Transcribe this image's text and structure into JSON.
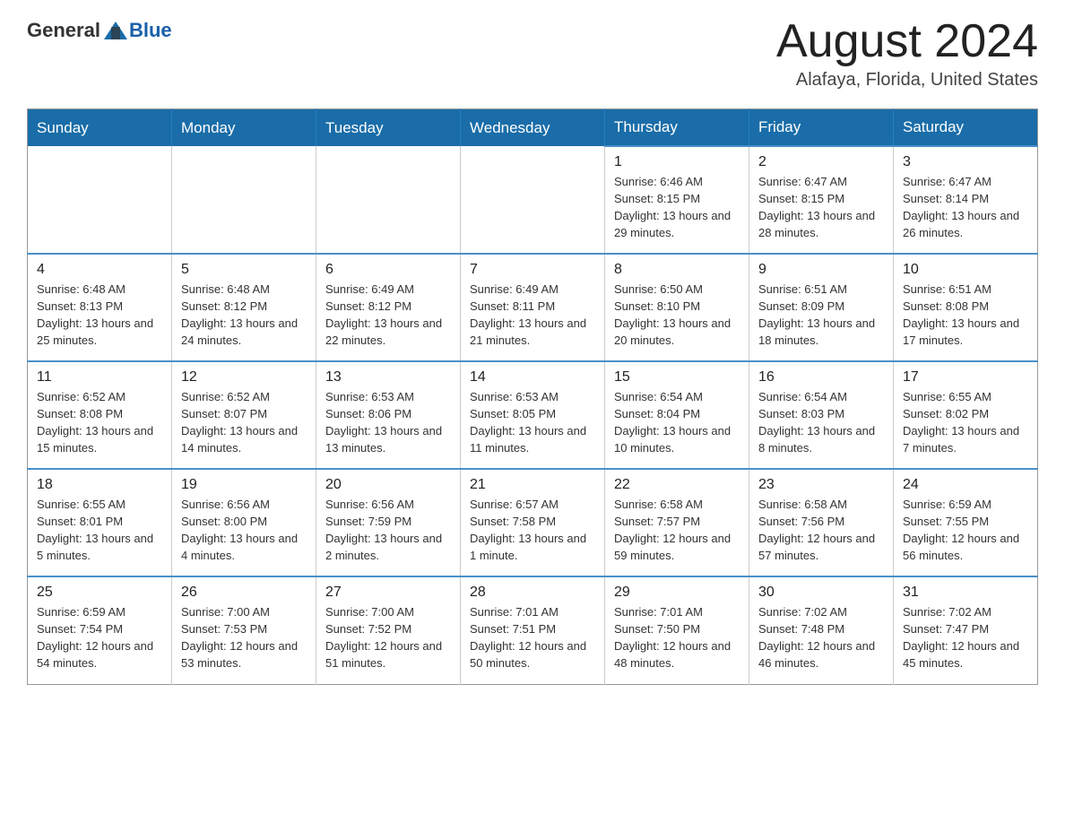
{
  "header": {
    "logo_general": "General",
    "logo_blue": "Blue",
    "month_year": "August 2024",
    "location": "Alafaya, Florida, United States"
  },
  "days_of_week": [
    "Sunday",
    "Monday",
    "Tuesday",
    "Wednesday",
    "Thursday",
    "Friday",
    "Saturday"
  ],
  "weeks": [
    [
      {
        "day": "",
        "sunrise": "",
        "sunset": "",
        "daylight": ""
      },
      {
        "day": "",
        "sunrise": "",
        "sunset": "",
        "daylight": ""
      },
      {
        "day": "",
        "sunrise": "",
        "sunset": "",
        "daylight": ""
      },
      {
        "day": "",
        "sunrise": "",
        "sunset": "",
        "daylight": ""
      },
      {
        "day": "1",
        "sunrise": "Sunrise: 6:46 AM",
        "sunset": "Sunset: 8:15 PM",
        "daylight": "Daylight: 13 hours and 29 minutes."
      },
      {
        "day": "2",
        "sunrise": "Sunrise: 6:47 AM",
        "sunset": "Sunset: 8:15 PM",
        "daylight": "Daylight: 13 hours and 28 minutes."
      },
      {
        "day": "3",
        "sunrise": "Sunrise: 6:47 AM",
        "sunset": "Sunset: 8:14 PM",
        "daylight": "Daylight: 13 hours and 26 minutes."
      }
    ],
    [
      {
        "day": "4",
        "sunrise": "Sunrise: 6:48 AM",
        "sunset": "Sunset: 8:13 PM",
        "daylight": "Daylight: 13 hours and 25 minutes."
      },
      {
        "day": "5",
        "sunrise": "Sunrise: 6:48 AM",
        "sunset": "Sunset: 8:12 PM",
        "daylight": "Daylight: 13 hours and 24 minutes."
      },
      {
        "day": "6",
        "sunrise": "Sunrise: 6:49 AM",
        "sunset": "Sunset: 8:12 PM",
        "daylight": "Daylight: 13 hours and 22 minutes."
      },
      {
        "day": "7",
        "sunrise": "Sunrise: 6:49 AM",
        "sunset": "Sunset: 8:11 PM",
        "daylight": "Daylight: 13 hours and 21 minutes."
      },
      {
        "day": "8",
        "sunrise": "Sunrise: 6:50 AM",
        "sunset": "Sunset: 8:10 PM",
        "daylight": "Daylight: 13 hours and 20 minutes."
      },
      {
        "day": "9",
        "sunrise": "Sunrise: 6:51 AM",
        "sunset": "Sunset: 8:09 PM",
        "daylight": "Daylight: 13 hours and 18 minutes."
      },
      {
        "day": "10",
        "sunrise": "Sunrise: 6:51 AM",
        "sunset": "Sunset: 8:08 PM",
        "daylight": "Daylight: 13 hours and 17 minutes."
      }
    ],
    [
      {
        "day": "11",
        "sunrise": "Sunrise: 6:52 AM",
        "sunset": "Sunset: 8:08 PM",
        "daylight": "Daylight: 13 hours and 15 minutes."
      },
      {
        "day": "12",
        "sunrise": "Sunrise: 6:52 AM",
        "sunset": "Sunset: 8:07 PM",
        "daylight": "Daylight: 13 hours and 14 minutes."
      },
      {
        "day": "13",
        "sunrise": "Sunrise: 6:53 AM",
        "sunset": "Sunset: 8:06 PM",
        "daylight": "Daylight: 13 hours and 13 minutes."
      },
      {
        "day": "14",
        "sunrise": "Sunrise: 6:53 AM",
        "sunset": "Sunset: 8:05 PM",
        "daylight": "Daylight: 13 hours and 11 minutes."
      },
      {
        "day": "15",
        "sunrise": "Sunrise: 6:54 AM",
        "sunset": "Sunset: 8:04 PM",
        "daylight": "Daylight: 13 hours and 10 minutes."
      },
      {
        "day": "16",
        "sunrise": "Sunrise: 6:54 AM",
        "sunset": "Sunset: 8:03 PM",
        "daylight": "Daylight: 13 hours and 8 minutes."
      },
      {
        "day": "17",
        "sunrise": "Sunrise: 6:55 AM",
        "sunset": "Sunset: 8:02 PM",
        "daylight": "Daylight: 13 hours and 7 minutes."
      }
    ],
    [
      {
        "day": "18",
        "sunrise": "Sunrise: 6:55 AM",
        "sunset": "Sunset: 8:01 PM",
        "daylight": "Daylight: 13 hours and 5 minutes."
      },
      {
        "day": "19",
        "sunrise": "Sunrise: 6:56 AM",
        "sunset": "Sunset: 8:00 PM",
        "daylight": "Daylight: 13 hours and 4 minutes."
      },
      {
        "day": "20",
        "sunrise": "Sunrise: 6:56 AM",
        "sunset": "Sunset: 7:59 PM",
        "daylight": "Daylight: 13 hours and 2 minutes."
      },
      {
        "day": "21",
        "sunrise": "Sunrise: 6:57 AM",
        "sunset": "Sunset: 7:58 PM",
        "daylight": "Daylight: 13 hours and 1 minute."
      },
      {
        "day": "22",
        "sunrise": "Sunrise: 6:58 AM",
        "sunset": "Sunset: 7:57 PM",
        "daylight": "Daylight: 12 hours and 59 minutes."
      },
      {
        "day": "23",
        "sunrise": "Sunrise: 6:58 AM",
        "sunset": "Sunset: 7:56 PM",
        "daylight": "Daylight: 12 hours and 57 minutes."
      },
      {
        "day": "24",
        "sunrise": "Sunrise: 6:59 AM",
        "sunset": "Sunset: 7:55 PM",
        "daylight": "Daylight: 12 hours and 56 minutes."
      }
    ],
    [
      {
        "day": "25",
        "sunrise": "Sunrise: 6:59 AM",
        "sunset": "Sunset: 7:54 PM",
        "daylight": "Daylight: 12 hours and 54 minutes."
      },
      {
        "day": "26",
        "sunrise": "Sunrise: 7:00 AM",
        "sunset": "Sunset: 7:53 PM",
        "daylight": "Daylight: 12 hours and 53 minutes."
      },
      {
        "day": "27",
        "sunrise": "Sunrise: 7:00 AM",
        "sunset": "Sunset: 7:52 PM",
        "daylight": "Daylight: 12 hours and 51 minutes."
      },
      {
        "day": "28",
        "sunrise": "Sunrise: 7:01 AM",
        "sunset": "Sunset: 7:51 PM",
        "daylight": "Daylight: 12 hours and 50 minutes."
      },
      {
        "day": "29",
        "sunrise": "Sunrise: 7:01 AM",
        "sunset": "Sunset: 7:50 PM",
        "daylight": "Daylight: 12 hours and 48 minutes."
      },
      {
        "day": "30",
        "sunrise": "Sunrise: 7:02 AM",
        "sunset": "Sunset: 7:48 PM",
        "daylight": "Daylight: 12 hours and 46 minutes."
      },
      {
        "day": "31",
        "sunrise": "Sunrise: 7:02 AM",
        "sunset": "Sunset: 7:47 PM",
        "daylight": "Daylight: 12 hours and 45 minutes."
      }
    ]
  ]
}
